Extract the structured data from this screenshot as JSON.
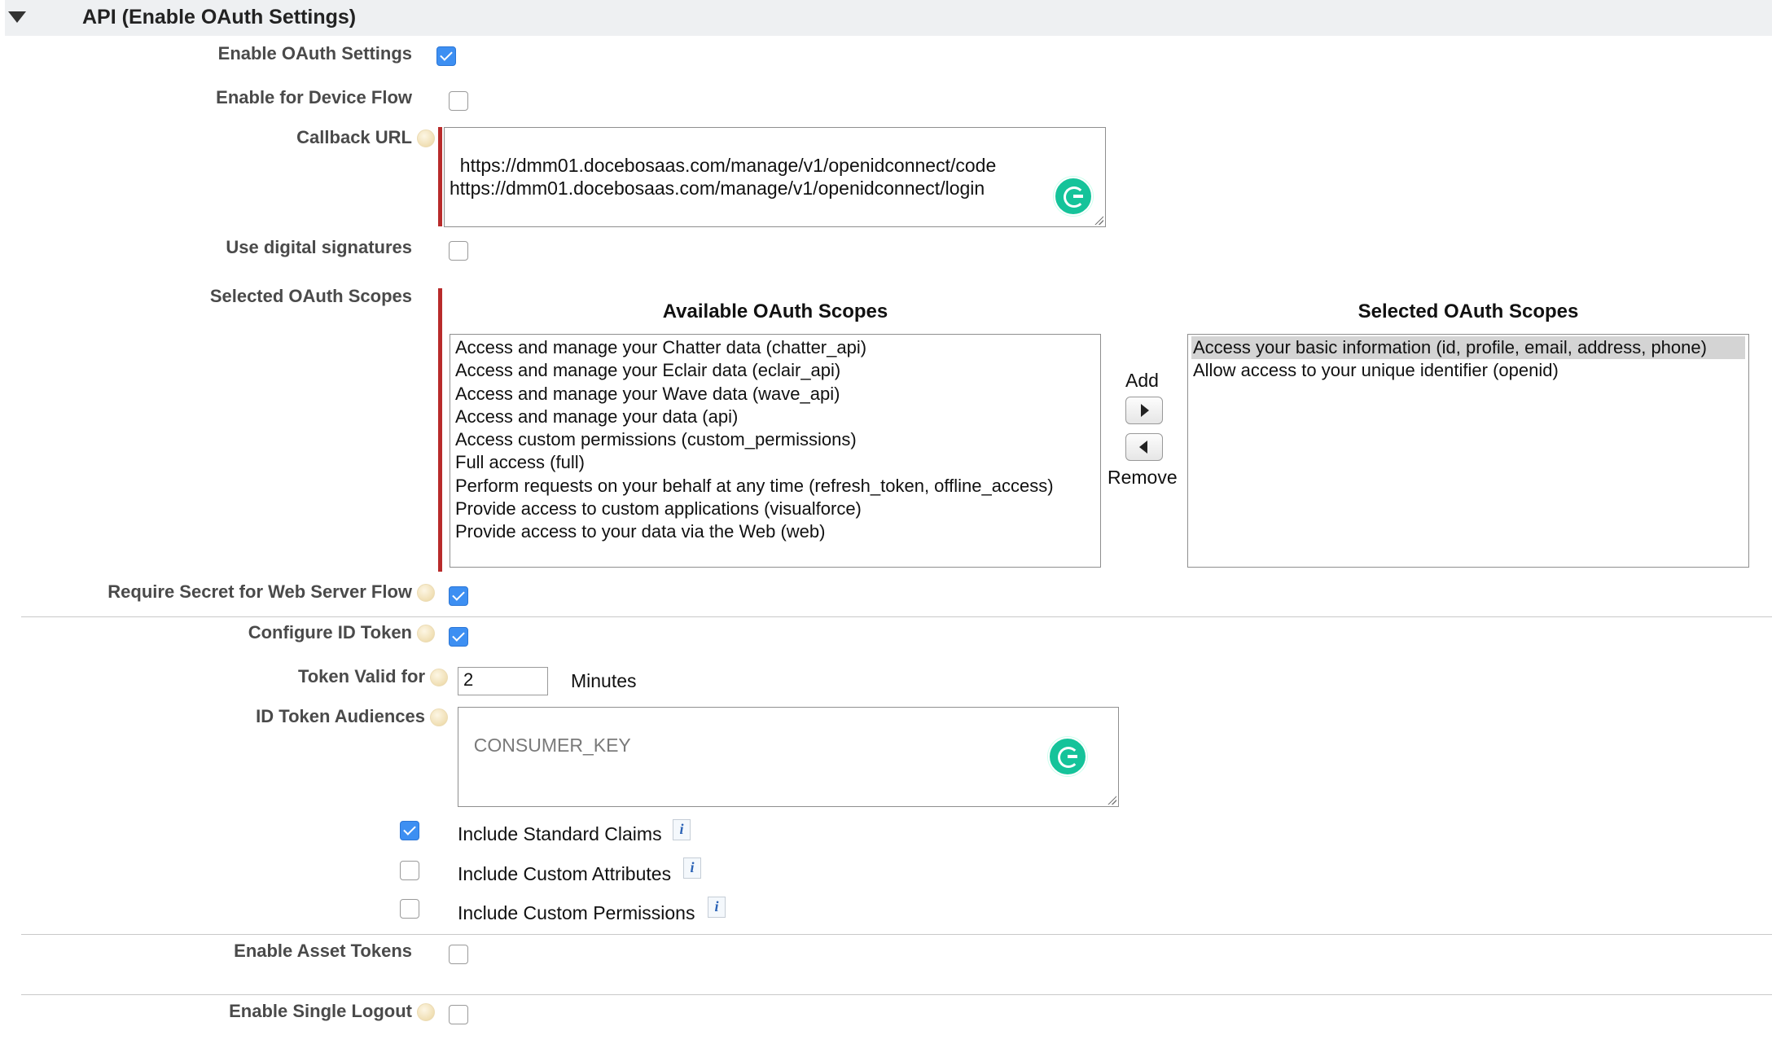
{
  "section": {
    "title": "API (Enable OAuth Settings)"
  },
  "fields": {
    "enable_oauth": {
      "label": "Enable OAuth Settings",
      "checked": true
    },
    "device_flow": {
      "label": "Enable for Device Flow",
      "checked": false
    },
    "callback_url": {
      "label": "Callback URL",
      "value": "https://dmm01.docebosaas.com/manage/v1/openidconnect/code\nhttps://dmm01.docebosaas.com/manage/v1/openidconnect/login"
    },
    "digital_signatures": {
      "label": "Use digital signatures",
      "checked": false
    },
    "scopes": {
      "label": "Selected OAuth Scopes",
      "available_title": "Available OAuth Scopes",
      "selected_title": "Selected OAuth Scopes",
      "available": [
        "Access and manage your Chatter data (chatter_api)",
        "Access and manage your Eclair data (eclair_api)",
        "Access and manage your Wave data (wave_api)",
        "Access and manage your data (api)",
        "Access custom permissions (custom_permissions)",
        "Full access (full)",
        "Perform requests on your behalf at any time (refresh_token, offline_access)",
        "Provide access to custom applications (visualforce)",
        "Provide access to your data via the Web (web)"
      ],
      "selected": [
        "Access your basic information (id, profile, email, address, phone)",
        "Allow access to your unique identifier (openid)"
      ],
      "add_label": "Add",
      "remove_label": "Remove"
    },
    "require_secret": {
      "label": "Require Secret for Web Server Flow",
      "checked": true
    },
    "configure_id_token": {
      "label": "Configure ID Token",
      "checked": true
    },
    "token_valid": {
      "label": "Token Valid for",
      "value": "2",
      "unit": "Minutes"
    },
    "id_token_audiences": {
      "label": "ID Token Audiences",
      "placeholder": "CONSUMER_KEY"
    },
    "claims": [
      {
        "label": "Include Standard Claims",
        "checked": true
      },
      {
        "label": "Include Custom Attributes",
        "checked": false
      },
      {
        "label": "Include Custom Permissions",
        "checked": false
      }
    ],
    "asset_tokens": {
      "label": "Enable Asset Tokens",
      "checked": false
    },
    "single_logout": {
      "label": "Enable Single Logout",
      "checked": false
    }
  },
  "icons": {
    "help": "help-icon",
    "info": "i",
    "grammarly": "grammarly-icon"
  },
  "colors": {
    "required_bar": "#b82b2b",
    "checkbox_on": "#3d8ff2",
    "header_bg": "#eef0f2",
    "grammarly": "#15c39a"
  }
}
